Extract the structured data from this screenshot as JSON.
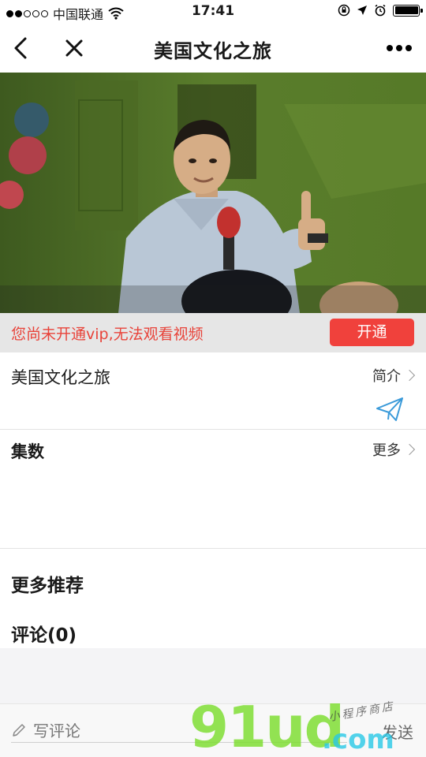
{
  "status_bar": {
    "carrier": "中国联通",
    "time": "17:41"
  },
  "nav": {
    "title": "美国文化之旅"
  },
  "vip": {
    "message": "您尚未开通vip,无法观看视频",
    "button_label": "开通"
  },
  "course": {
    "title": "美国文化之旅",
    "intro_label": "简介"
  },
  "episodes": {
    "title": "集数",
    "more_label": "更多"
  },
  "sections": {
    "recommend_title": "更多推荐",
    "comments_title": "评论(0)"
  },
  "comment_bar": {
    "placeholder": "写评论",
    "send_label": "发送"
  },
  "watermark": {
    "brand": "91ud",
    "domain": ".com",
    "tagline": "小程序商店"
  },
  "colors": {
    "accent_red": "#f0413c",
    "vip_text_red": "#e8433a",
    "share_icon_blue": "#3a9ad9"
  }
}
